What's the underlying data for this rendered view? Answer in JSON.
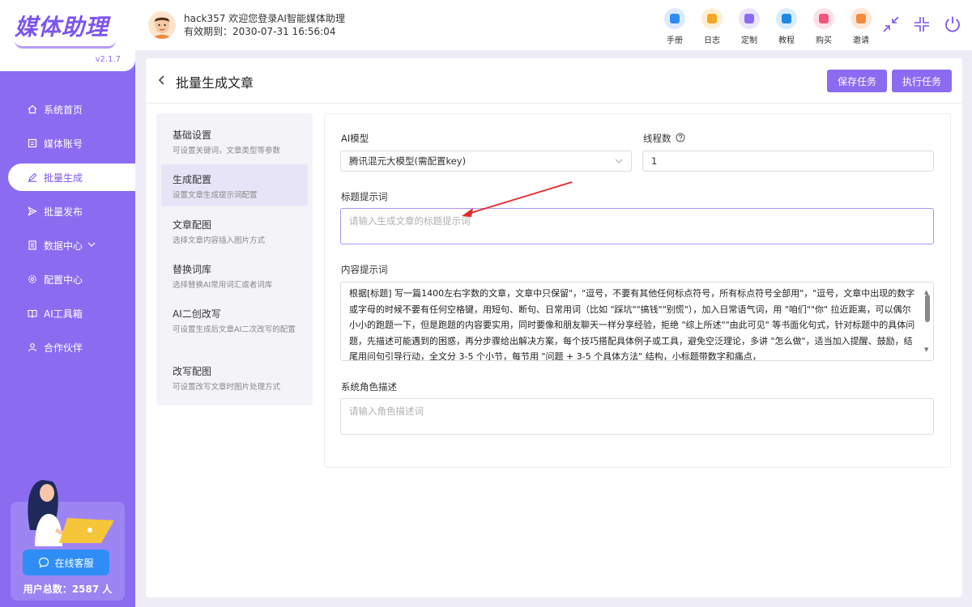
{
  "app": {
    "logo": "媒体助理",
    "version": "v2.1.7"
  },
  "sidebar": {
    "items": [
      {
        "label": "系统首页",
        "icon": "home-icon"
      },
      {
        "label": "媒体账号",
        "icon": "account-icon"
      },
      {
        "label": "批量生成",
        "icon": "pen-icon"
      },
      {
        "label": "批量发布",
        "icon": "send-icon"
      },
      {
        "label": "数据中心",
        "icon": "data-icon"
      },
      {
        "label": "配置中心",
        "icon": "gear-icon"
      },
      {
        "label": "AI工具箱",
        "icon": "toolbox-icon"
      },
      {
        "label": "合作伙伴",
        "icon": "partner-icon"
      }
    ],
    "active_index": 2,
    "customer_service": "在线客服",
    "user_count": "用户总数：2587 人"
  },
  "header": {
    "welcome": "hack357 欢迎您登录AI智能媒体助理",
    "expiry": "有效期到：2030-07-31 16:56:04",
    "tools": [
      {
        "label": "手册",
        "color": "#2d8cf0",
        "bg": "#dbeafc",
        "icon": "manual-icon"
      },
      {
        "label": "日志",
        "color": "#f5a623",
        "bg": "#fdefd6",
        "icon": "log-icon"
      },
      {
        "label": "定制",
        "color": "#8b6cf0",
        "bg": "#ebe5fc",
        "icon": "custom-icon"
      },
      {
        "label": "教程",
        "color": "#1e88e5",
        "bg": "#d9ecfb",
        "icon": "tutorial-icon"
      },
      {
        "label": "购买",
        "color": "#f0567a",
        "bg": "#fde1e8",
        "icon": "buy-icon"
      },
      {
        "label": "邀请",
        "color": "#f58a3c",
        "bg": "#fde8d8",
        "icon": "invite-icon"
      }
    ]
  },
  "page": {
    "title": "批量生成文章",
    "save_button": "保存任务",
    "run_button": "执行任务"
  },
  "steps": [
    {
      "title": "基础设置",
      "desc": "可设置关键词，文章类型等参数"
    },
    {
      "title": "生成配置",
      "desc": "设置文章生成提示词配置"
    },
    {
      "title": "文章配图",
      "desc": "选择文章内容插入图片方式"
    },
    {
      "title": "替换词库",
      "desc": "选择替换AI常用词汇或者词库"
    },
    {
      "title": "AI二创改写",
      "desc": "可设置生成后文章AI二次改写的配置"
    },
    {
      "title": "改写配图",
      "desc": "可设置改写文章时图片处理方式"
    }
  ],
  "form": {
    "model_label": "AI模型",
    "model_value": "腾讯混元大模型(需配置key)",
    "threads_label": "线程数",
    "threads_value": "1",
    "title_prompt_label": "标题提示词",
    "title_prompt_placeholder": "请输入生成文章的标题提示词",
    "content_prompt_label": "内容提示词",
    "content_prompt_value": "根据[标题] 写一篇1400左右字数的文章，文章中只保留\"，\"逗号，不要有其他任何标点符号，所有标点符号全部用\"，\"逗号，文章中出现的数字或字母的时候不要有任何空格键，用短句、断句、日常用词（比如 \"踩坑\"\"搞钱\"\"别慌\"），加入日常语气词，用 \"咱们\"\"你\" 拉近距离，可以偶尔小小的跑题一下，但是跑题的内容要实用，同时要像和朋友聊天一样分享经验，拒绝 \"综上所述\"\"由此可见\" 等书面化句式，针对标题中的具体问题，先描述可能遇到的困惑，再分步骤给出解决方案，每个技巧搭配具体例子或工具，避免空泛理论，多讲 \"怎么做\"，适当加入提醒、鼓励，结尾用问句引导行动，全文分 3-5 个小节，每节用 \"问题 + 3-5 个具体方法\" 结构，小标题带数字和痛点，",
    "role_label": "系统角色描述",
    "role_placeholder": "请输入角色描述词"
  }
}
